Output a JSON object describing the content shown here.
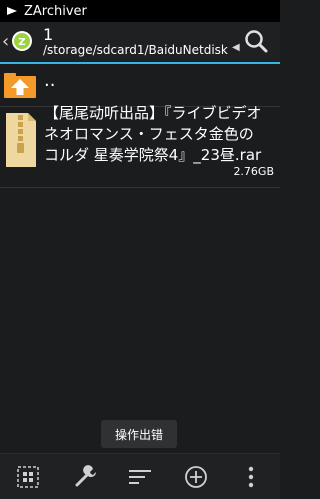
{
  "titlebar": {
    "app_title": "ZArchiver"
  },
  "pathbar": {
    "folder_count": "1",
    "path": "/storage/sdcard1/BaiduNetdisk"
  },
  "list": {
    "up_label": "..",
    "items": [
      {
        "name": "【尾尾动听出品】『ライブビデオ ネオロマンス・フェスタ金色のコルダ 星奏学院祭4』_23昼.rar",
        "size": "2.76GB",
        "type": "rar-archive"
      }
    ]
  },
  "toast": {
    "text": "操作出错"
  },
  "toolbar": {
    "buttons": [
      "select-icon",
      "wrench-icon",
      "sort-icon",
      "add-icon",
      "overflow-menu-icon"
    ]
  },
  "colors": {
    "background": "#1b1c1e",
    "accent_line": "#33b5e5",
    "folder_orange": "#f39a2b",
    "logo_green": "#9bd43c"
  }
}
